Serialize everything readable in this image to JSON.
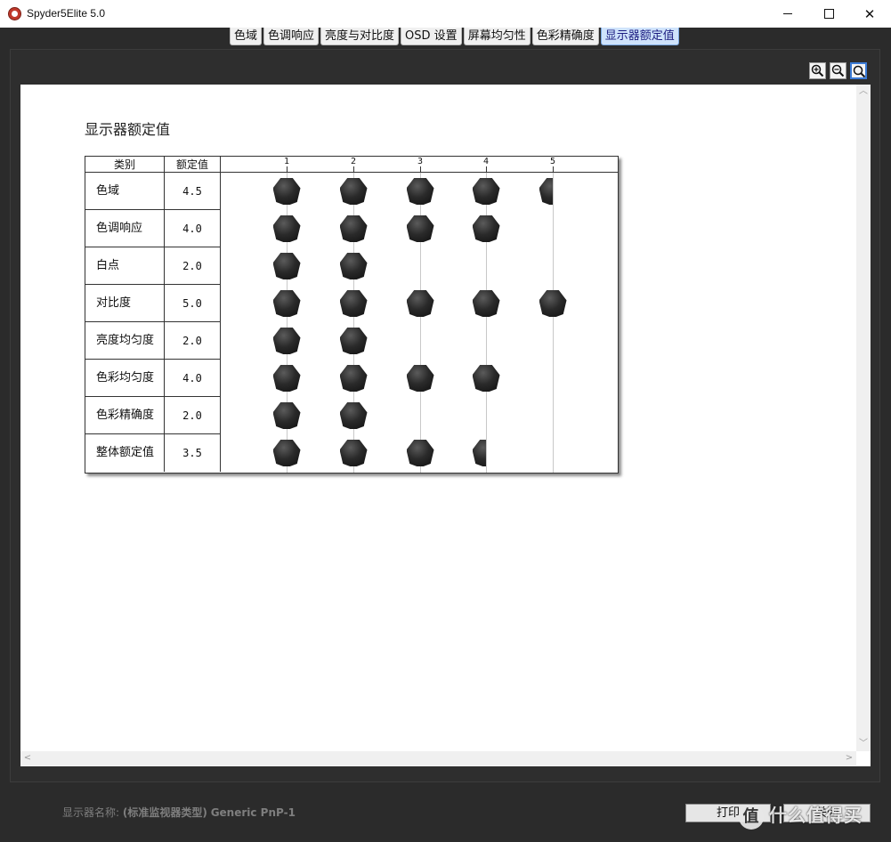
{
  "window": {
    "title": "Spyder5Elite 5.0",
    "close_glyph": "✕"
  },
  "tabs": [
    {
      "label": "色域"
    },
    {
      "label": "色调响应"
    },
    {
      "label": "亮度与对比度"
    },
    {
      "label": "OSD 设置"
    },
    {
      "label": "屏幕均匀性"
    },
    {
      "label": "色彩精确度"
    },
    {
      "label": "显示器额定值",
      "active": true
    }
  ],
  "toolbar": {
    "icons": [
      "zoom-in-icon",
      "zoom-out-icon",
      "zoom-fit-icon"
    ]
  },
  "report": {
    "title": "显示器额定值",
    "table": {
      "header_category": "类别",
      "header_value": "额定值",
      "scale": [
        "1",
        "2",
        "3",
        "4",
        "5"
      ],
      "rows": [
        {
          "category": "色域",
          "value": "4.5"
        },
        {
          "category": "色调响应",
          "value": "4.0"
        },
        {
          "category": "白点",
          "value": "2.0"
        },
        {
          "category": "对比度",
          "value": "5.0"
        },
        {
          "category": "亮度均匀度",
          "value": "2.0"
        },
        {
          "category": "色彩均匀度",
          "value": "4.0"
        },
        {
          "category": "色彩精确度",
          "value": "2.0"
        },
        {
          "category": "整体额定值",
          "value": "3.5"
        }
      ]
    }
  },
  "footer": {
    "display_name_label": "显示器名称:",
    "display_name_type": "(标准监视器类型)",
    "display_name_model": "Generic PnP-1",
    "print_button": "打印",
    "close_button": "关闭",
    "watermark": "什么值得买"
  },
  "colors": {
    "background": "#2b2b2b",
    "active_tab": "#cfe3fb",
    "puck": "#1a1a1a"
  }
}
